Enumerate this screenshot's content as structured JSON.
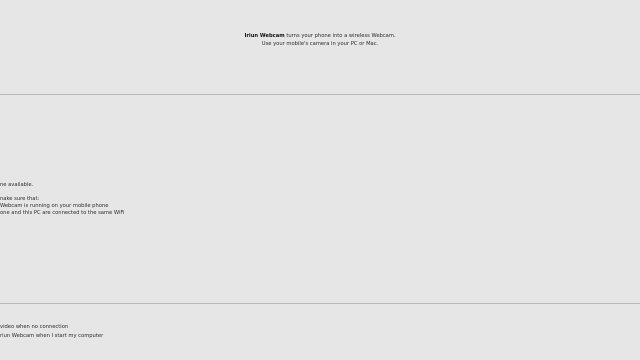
{
  "intro": {
    "app_name": "Iriun Webcam",
    "line1_rest": "turns your phone into a wireless Webcam.",
    "line2": "Use your mobile's camera in your PC or Mac."
  },
  "status": {
    "heading": "ne available.",
    "check_intro": "nake sure that:",
    "check_item_1": "Webcam is running on your mobile phone",
    "check_item_2": "one and this PC are connected to the same WiFi"
  },
  "options": {
    "option_1": "video when no connection",
    "option_2": "riun Webcam when I start my computer"
  }
}
